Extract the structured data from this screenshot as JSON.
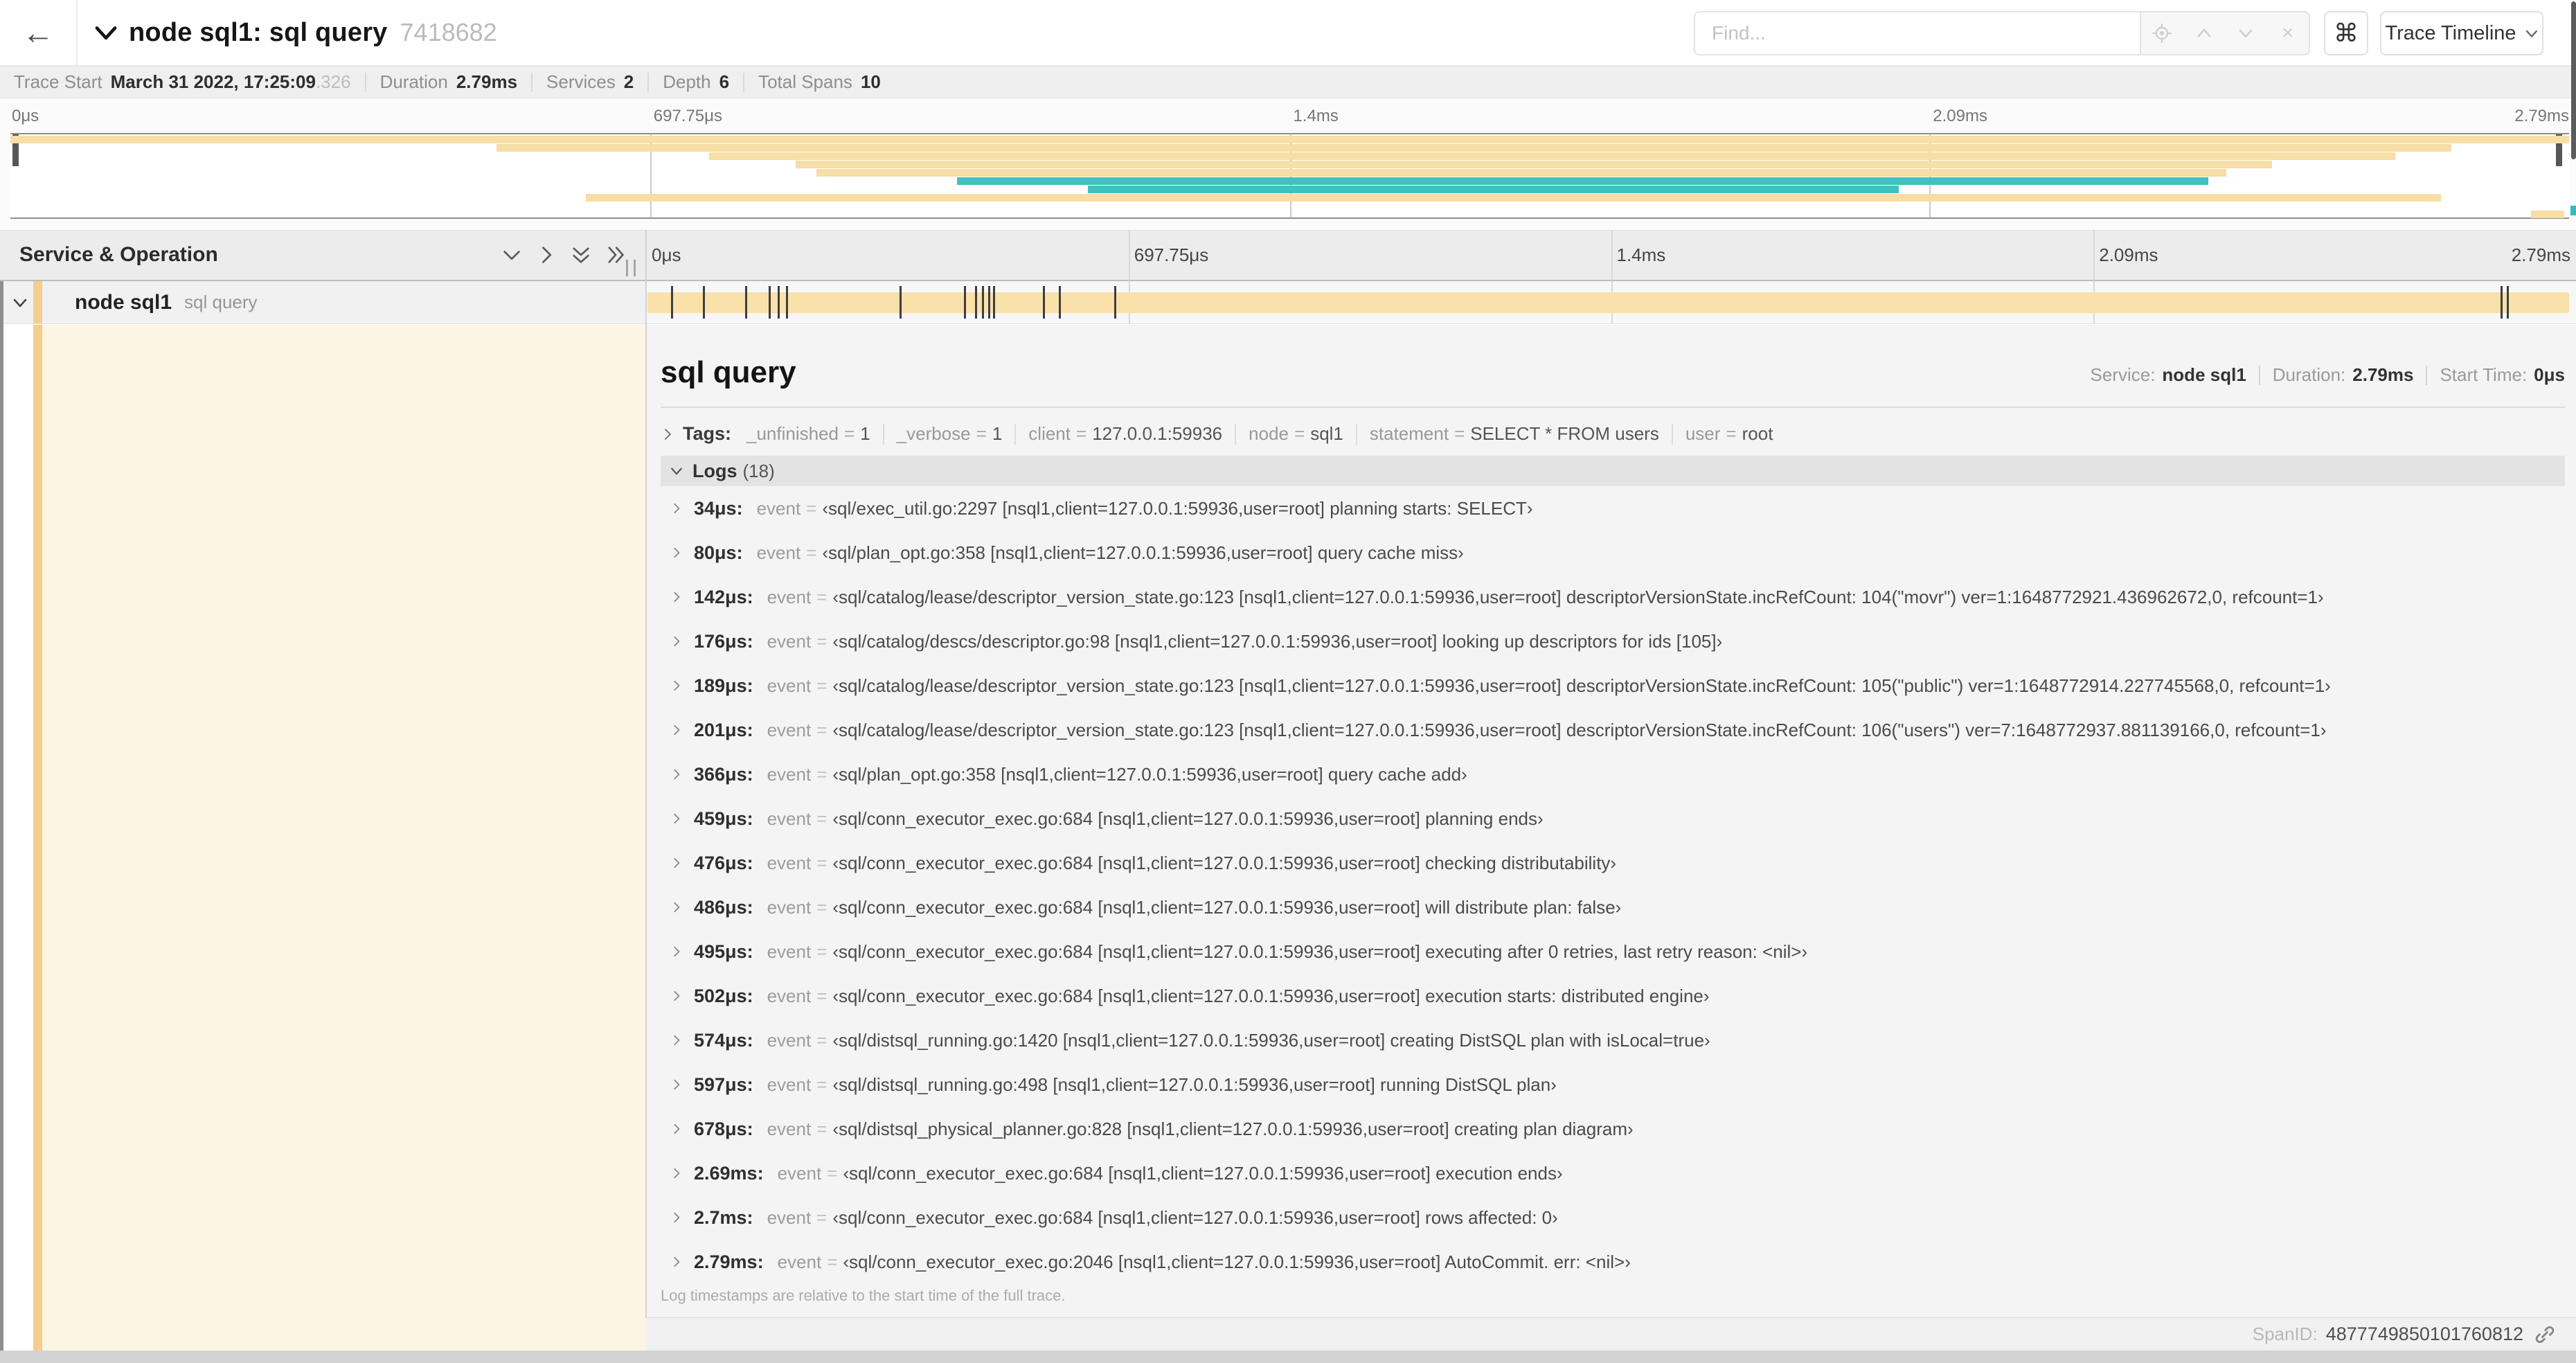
{
  "header": {
    "back_icon": "←",
    "title": "node sql1: sql query",
    "trace_id": "7418682",
    "find_placeholder": "Find...",
    "clear_icon": "×",
    "cmd_glyph": "⌘",
    "view_button": "Trace Timeline"
  },
  "stats": {
    "items": [
      {
        "label": "Trace Start",
        "value": "March 31 2022, 17:25:09",
        "suffix": ".326"
      },
      {
        "label": "Duration",
        "value": "2.79ms"
      },
      {
        "label": "Services",
        "value": "2"
      },
      {
        "label": "Depth",
        "value": "6"
      },
      {
        "label": "Total Spans",
        "value": "10"
      }
    ]
  },
  "axis": [
    {
      "label": "0μs",
      "pct": 0
    },
    {
      "label": "697.75μs",
      "pct": 25
    },
    {
      "label": "1.4ms",
      "pct": 50
    },
    {
      "label": "2.09ms",
      "pct": 75
    },
    {
      "label": "2.79ms",
      "pct": 100
    }
  ],
  "minimap": {
    "rows": [
      {
        "color": "tan",
        "start": 0,
        "end": 100
      },
      {
        "color": "tan",
        "start": 19,
        "end": 95.4
      },
      {
        "color": "tan",
        "start": 27.3,
        "end": 93.2
      },
      {
        "color": "tan",
        "start": 30.7,
        "end": 88.4
      },
      {
        "color": "tan",
        "start": 31.5,
        "end": 86.6
      },
      {
        "color": "teal",
        "start": 37,
        "end": 85.9
      },
      {
        "color": "teal",
        "start": 42.1,
        "end": 73.8
      },
      {
        "color": "tan",
        "start": 22.5,
        "end": 95
      },
      null,
      {
        "color": "tan",
        "start": 98.5,
        "end": 99.8
      }
    ]
  },
  "timeline": {
    "left_header": "Service & Operation",
    "total_us": 2790,
    "tick_times_us": [
      34,
      80,
      142,
      176,
      189,
      201,
      366,
      459,
      476,
      486,
      495,
      502,
      574,
      597,
      678,
      2690,
      2700
    ]
  },
  "span": {
    "service": "node sql1",
    "operation": "sql query"
  },
  "detail": {
    "title": "sql query",
    "meta": [
      {
        "label": "Service:",
        "value": "node sql1"
      },
      {
        "label": "Duration:",
        "value": "2.79ms"
      },
      {
        "label": "Start Time:",
        "value": "0μs"
      }
    ],
    "tags_label": "Tags:",
    "tags": [
      {
        "key": "_unfinished",
        "value": "1"
      },
      {
        "key": "_verbose",
        "value": "1"
      },
      {
        "key": "client",
        "value": "127.0.0.1:59936"
      },
      {
        "key": "node",
        "value": "sql1"
      },
      {
        "key": "statement",
        "value": "SELECT * FROM users"
      },
      {
        "key": "user",
        "value": "root"
      }
    ],
    "logs_label": "Logs",
    "logs_count": "(18)",
    "logs": [
      {
        "time": "34μs:",
        "key": "event",
        "value": "‹sql/exec_util.go:2297 [nsql1,client=127.0.0.1:59936,user=root] planning starts: SELECT›"
      },
      {
        "time": "80μs:",
        "key": "event",
        "value": "‹sql/plan_opt.go:358 [nsql1,client=127.0.0.1:59936,user=root] query cache miss›"
      },
      {
        "time": "142μs:",
        "key": "event",
        "value": "‹sql/catalog/lease/descriptor_version_state.go:123 [nsql1,client=127.0.0.1:59936,user=root] descriptorVersionState.incRefCount: 104(\"movr\") ver=1:1648772921.436962672,0, refcount=1›"
      },
      {
        "time": "176μs:",
        "key": "event",
        "value": "‹sql/catalog/descs/descriptor.go:98 [nsql1,client=127.0.0.1:59936,user=root] looking up descriptors for ids [105]›"
      },
      {
        "time": "189μs:",
        "key": "event",
        "value": "‹sql/catalog/lease/descriptor_version_state.go:123 [nsql1,client=127.0.0.1:59936,user=root] descriptorVersionState.incRefCount: 105(\"public\") ver=1:1648772914.227745568,0, refcount=1›"
      },
      {
        "time": "201μs:",
        "key": "event",
        "value": "‹sql/catalog/lease/descriptor_version_state.go:123 [nsql1,client=127.0.0.1:59936,user=root] descriptorVersionState.incRefCount: 106(\"users\") ver=7:1648772937.881139166,0, refcount=1›"
      },
      {
        "time": "366μs:",
        "key": "event",
        "value": "‹sql/plan_opt.go:358 [nsql1,client=127.0.0.1:59936,user=root] query cache add›"
      },
      {
        "time": "459μs:",
        "key": "event",
        "value": "‹sql/conn_executor_exec.go:684 [nsql1,client=127.0.0.1:59936,user=root] planning ends›"
      },
      {
        "time": "476μs:",
        "key": "event",
        "value": "‹sql/conn_executor_exec.go:684 [nsql1,client=127.0.0.1:59936,user=root] checking distributability›"
      },
      {
        "time": "486μs:",
        "key": "event",
        "value": "‹sql/conn_executor_exec.go:684 [nsql1,client=127.0.0.1:59936,user=root] will distribute plan: false›"
      },
      {
        "time": "495μs:",
        "key": "event",
        "value": "‹sql/conn_executor_exec.go:684 [nsql1,client=127.0.0.1:59936,user=root] executing after 0 retries, last retry reason: <nil>›"
      },
      {
        "time": "502μs:",
        "key": "event",
        "value": "‹sql/conn_executor_exec.go:684 [nsql1,client=127.0.0.1:59936,user=root] execution starts: distributed engine›"
      },
      {
        "time": "574μs:",
        "key": "event",
        "value": "‹sql/distsql_running.go:1420 [nsql1,client=127.0.0.1:59936,user=root] creating DistSQL plan with isLocal=true›"
      },
      {
        "time": "597μs:",
        "key": "event",
        "value": "‹sql/distsql_running.go:498 [nsql1,client=127.0.0.1:59936,user=root] running DistSQL plan›"
      },
      {
        "time": "678μs:",
        "key": "event",
        "value": "‹sql/distsql_physical_planner.go:828 [nsql1,client=127.0.0.1:59936,user=root] creating plan diagram›"
      },
      {
        "time": "2.69ms:",
        "key": "event",
        "value": "‹sql/conn_executor_exec.go:684 [nsql1,client=127.0.0.1:59936,user=root] execution ends›"
      },
      {
        "time": "2.7ms:",
        "key": "event",
        "value": "‹sql/conn_executor_exec.go:684 [nsql1,client=127.0.0.1:59936,user=root] rows affected: 0›"
      },
      {
        "time": "2.79ms:",
        "key": "event",
        "value": "‹sql/conn_executor_exec.go:2046 [nsql1,client=127.0.0.1:59936,user=root] AutoCommit. err: <nil>›"
      }
    ],
    "footer_note": "Log timestamps are relative to the start time of the full trace.",
    "span_id_label": "SpanID:",
    "span_id": "4877749850101760812"
  },
  "colors": {
    "tan": "#f6dea4",
    "teal": "#41c0c0",
    "bar": "#f9e1a9",
    "stripe": "#f5ce8e",
    "cream": "#fcf5e3"
  }
}
